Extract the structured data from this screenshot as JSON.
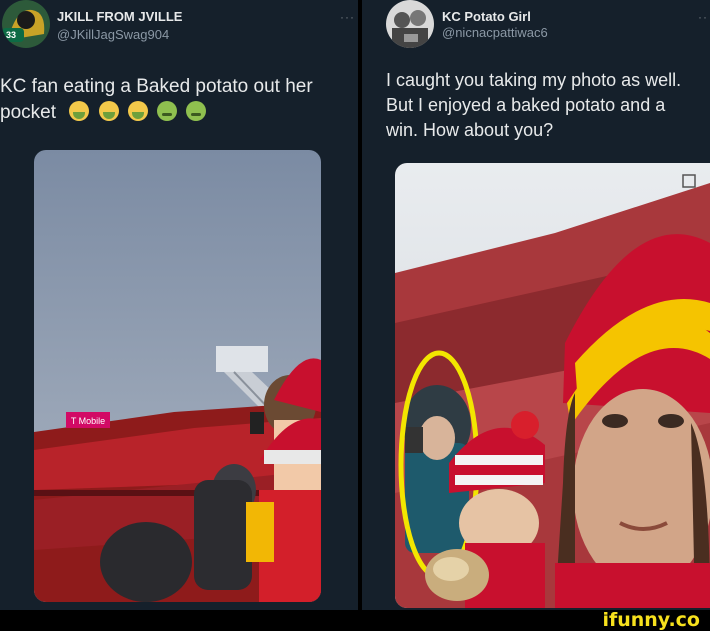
{
  "left_tweet": {
    "display_name": "JKILL FROM JVILLE",
    "handle": "@JKillJagSwag904",
    "more": "···",
    "text_line1": "KC fan eating a Baked potato out her",
    "text_line2": "pocket",
    "emojis": [
      "face-vomiting-icon",
      "face-vomiting-icon",
      "face-vomiting-icon",
      "nauseated-face-icon",
      "nauseated-face-icon"
    ],
    "avatar_badge": "33",
    "stadium_sign": "T Mobile"
  },
  "right_tweet": {
    "display_name": "KC Potato Girl",
    "handle": "@nicnacpattiwac6",
    "more": "··",
    "text_line1": "I caught you taking my photo as well.",
    "text_line2": "But I enjoyed a baked potato and a",
    "text_line3": "win.  How about you?"
  },
  "watermark": "ifunny.co",
  "colors": {
    "tweet_bg": "#15202b",
    "text_primary": "#e7e9ea",
    "text_secondary": "#8b98a5",
    "chiefs_red": "#c8102e",
    "highlight_yellow": "#f2e600",
    "brand_yellow": "#f7e11d"
  }
}
